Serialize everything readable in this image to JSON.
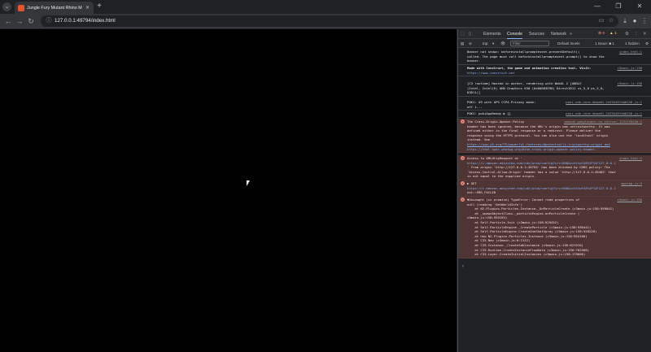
{
  "browser": {
    "tab_title": "Jungle Fury Mutant Rhino Mo...",
    "url": "127.0.0.1:49794/index.html"
  },
  "devtools": {
    "tabs": [
      "Elements",
      "Console",
      "Sources",
      "Network",
      "»"
    ],
    "active_tab": "Console",
    "errors_badge": "6",
    "warnings_badge": "1",
    "filter": {
      "context": "top",
      "placeholder": "Filter",
      "levels": "Default levels",
      "issues": "1 Issue: ■ 1",
      "hidden": "1 hidden"
    },
    "messages": [
      {
        "type": "info",
        "source": "index.html:1",
        "lines": [
          "Banner not shown: beforeinstallpromptevent.preventDefault()",
          "called. The page must call beforeinstallpromptevent.prompt() to show the",
          "banner."
        ]
      },
      {
        "type": "info",
        "source": "c3main.js:158",
        "lines": [
          "Made with Construct, the game and animation creation tool. Visit:"
        ],
        "link": "https://www.construct.net"
      },
      {
        "type": "info",
        "source": "c3main.js:158",
        "lines": [
          "[C3 runtime] Hosted in worker, rendering with WebGL 2 [ANGLE",
          "(Intel, Intel(R) UHD Graphics 630 (0x00003E98) Direct3D11 vs_5_0 ps_5_0,",
          "D3D11)]"
        ]
      },
      {
        "type": "info",
        "source": "poki-sdk-core-dbaa01.24394407db6346.js:1",
        "lines": [
          "POKI: A9 with APS CCPA Privacy mode:",
          "off 1---"
        ]
      },
      {
        "type": "info",
        "source": "poki-sdk-core-dbaa01.24394407db6346.js:1",
        "lines": [
          "POKI: pokiAppReady ▶ {}"
        ]
      },
      {
        "type": "error",
        "source": "imasdk.googleapis.co.id=vvar_1231f4929d:1",
        "lines": [
          "The Cross-Origin-Opener-Policy",
          "header has been ignored, because the URL's origin was untrustworthy. It was",
          "defined either in the final response or a redirect. Please deliver the",
          "response using the HTTPS protocol. You can also use the 'localhost' origin",
          "instead. See"
        ],
        "link": "https://www.w3.org/TR/powerful-features/#potentially-trustworthy-origin and",
        "link2": "https://html.spec.whatwg.org/#the-cross-origin-opener-policy-header."
      },
      {
        "type": "error",
        "source": "index.html:1",
        "lines": [
          "Access to XMLHttpRequest at '"
        ],
        "link": "https://c.amazon-adsystem.com/cdn/prod/config?src=600&u=http%3A%2F%2F127.0.0.1",
        "lines2": [
          "' from origin 'http://127.0.0.1:49794' has been blocked by CORS policy: The",
          "'Access-Control-Allow-Origin' header has a value 'http://127.0.0.1:49483' that",
          "is not equal to the supplied origin."
        ]
      },
      {
        "type": "error",
        "source": "apstag.js:3",
        "lines": [
          "▶ GET"
        ],
        "link": "https://c.amazon-adsystem.com/cdn/prod/config?src=600&u=http%3A%2F%2F127.0.0.1",
        "lines2": [
          "net::ERR_FAILED"
        ]
      },
      {
        "type": "error",
        "source": "c3main.js:158",
        "lines": [
          "▼Uncaught (in promise) TypeError: Cannot read properties of",
          "null (reading 'GetWorldInfo')",
          "    at N2.Plugins.Particles.Instance._OnParticleCreate (c3main.js:158:959042)",
          "    at _spawnObjectClass._particleEngine.onParticleCreate (",
          "c3main.js:158:959193)",
          "    at Self.Particle.Init (c3main.js:158:929452)",
          "    at Self.ParticleEngine._CreateParticle (c3main.js:158:930441)",
          "    at Self.ParticleEngine.CreateOneShotSpray (c3main.js:158:928228)",
          "    at new N2.Plugins.Particles.Instance (c3main.js:158:954108)",
          "    at C33.New (c3main.js:6:1122)",
          "    at C33.Instance._CreateSdkInstance (c3main.js:158:621910)",
          "    at C33.Runtime.CreateInstanceFromData (c3main.js:158:782568)",
          "    at C33.Layer.CreateInitialInstances (c3main.js:158:179666)"
        ]
      }
    ]
  }
}
